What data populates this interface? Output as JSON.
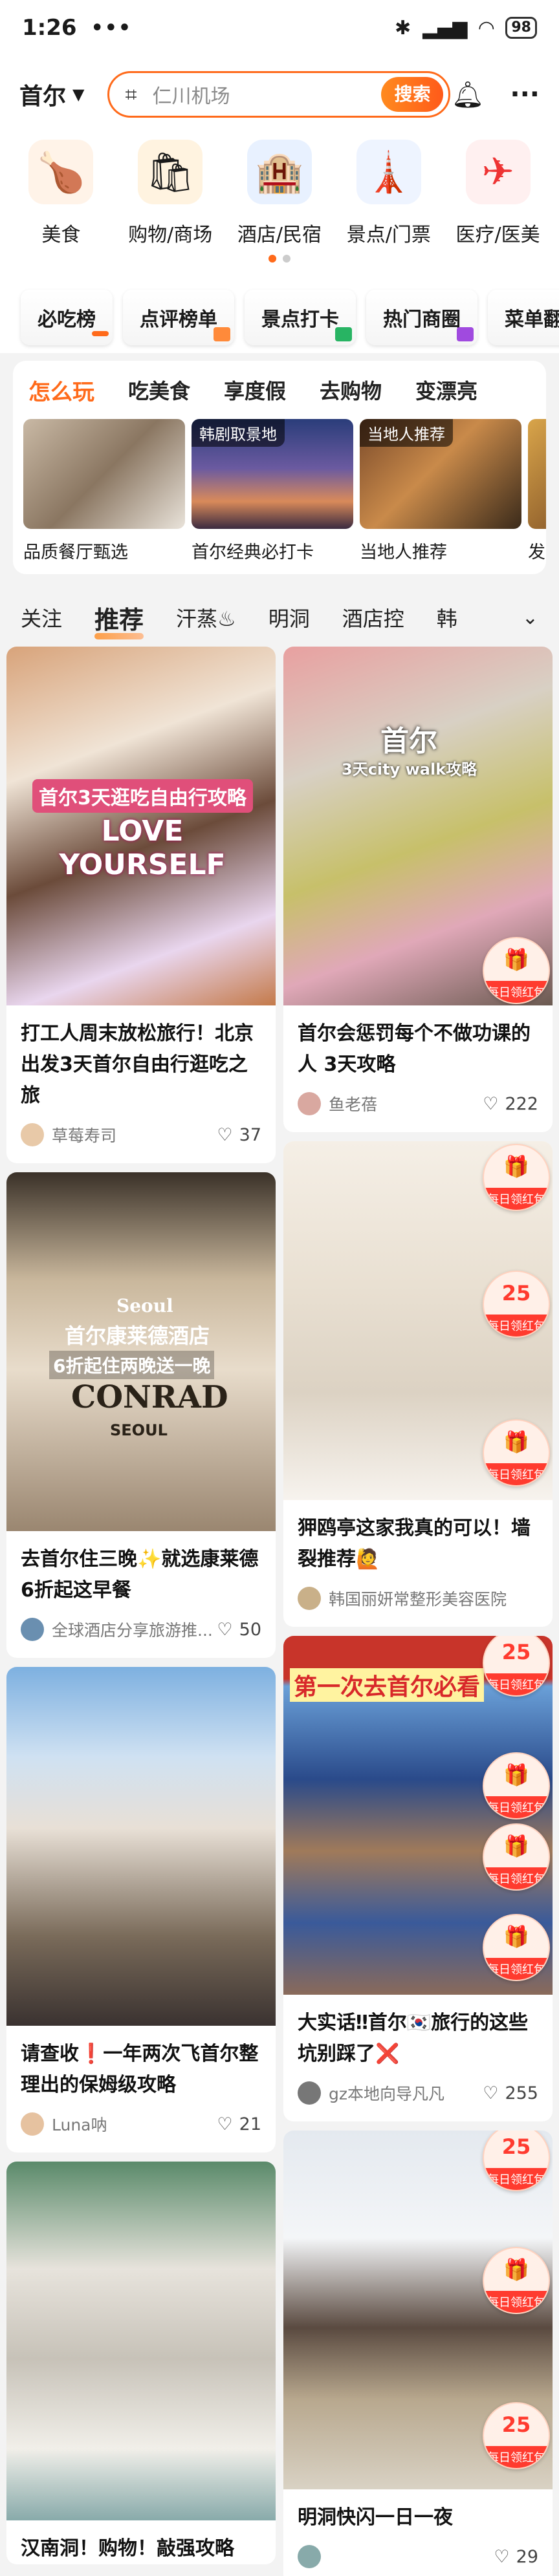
{
  "status": {
    "time": "1:26",
    "dots": "•••",
    "battery": "98"
  },
  "search": {
    "city": "首尔",
    "placeholder": "仁川机场",
    "button": "搜索"
  },
  "categories": [
    {
      "label": "美食",
      "icon": "🍗"
    },
    {
      "label": "购物/商场",
      "icon": "🛍"
    },
    {
      "label": "酒店/民宿",
      "icon": "🏨"
    },
    {
      "label": "景点/门票",
      "icon": "🗼"
    },
    {
      "label": "医疗/医美",
      "icon": "✈"
    }
  ],
  "rankings": [
    "必吃榜",
    "点评榜单",
    "景点打卡",
    "热门商圈",
    "菜单翻"
  ],
  "play": {
    "tabs": [
      "怎么玩",
      "吃美食",
      "享度假",
      "去购物",
      "变漂亮"
    ],
    "cards": [
      {
        "caption": "品质餐厅甄选",
        "tag": ""
      },
      {
        "caption": "首尔经典必打卡",
        "tag": "韩剧取景地"
      },
      {
        "caption": "当地人推荐",
        "tag": "当地人推荐"
      },
      {
        "caption": "发现",
        "tag": ""
      }
    ]
  },
  "feed_tabs": [
    "关注",
    "推荐",
    "汗蒸♨",
    "明洞",
    "酒店控",
    "韩"
  ],
  "badge": {
    "top": "25",
    "bottom": "每日领红包",
    "bottom2": "每日领红包"
  },
  "posts_left": [
    {
      "title": "打工人周末放松旅行！北京出发3天首尔自由行逛吃之旅",
      "author": "草莓寿司",
      "likes": "37",
      "overlay1": "首尔3天逛吃自由行攻略",
      "overlay2": "LOVE YOURSELF"
    },
    {
      "title": "去首尔住三晚✨就选康莱德6折起这早餐",
      "author": "全球酒店分享旅游推...",
      "likes": "50",
      "overlay1": "Seoul",
      "overlay2": "首尔康莱德酒店",
      "overlay3": "6折起住两晚送一晚",
      "overlay4": "CONRAD",
      "overlay5": "SEOUL"
    },
    {
      "title": "请查收❗一年两次飞首尔整理出的保姆级攻略",
      "author": "Luna呐",
      "likes": "21"
    },
    {
      "title": "汉南洞！购物！敲强攻略",
      "author": "",
      "likes": ""
    }
  ],
  "posts_right": [
    {
      "title": "首尔会惩罚每个不做功课的人 3天攻略",
      "author": "鱼老蓓",
      "likes": "222",
      "overlay1": "首尔",
      "overlay2": "3天city walk攻略"
    },
    {
      "title": "狎鸥亭这家我真的可以！墙裂推荐🙋",
      "author": "韩国丽妍常整形美容医院",
      "likes": ""
    },
    {
      "title": "大实话‼首尔🇰🇷旅行的这些坑别踩了❌",
      "author": "gz本地向导凡凡",
      "likes": "255",
      "overlay1": "第一次去首尔必看"
    },
    {
      "title": "明洞快闪一日一夜",
      "author": "",
      "likes": "29"
    }
  ]
}
